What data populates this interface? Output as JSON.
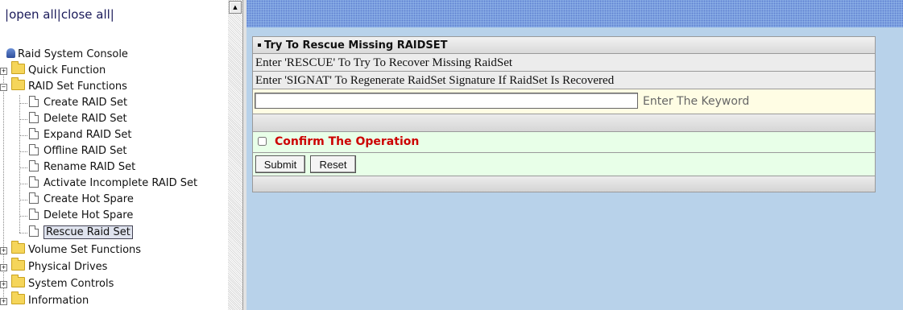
{
  "nav": {
    "open_all": "open all",
    "close_all": "close all",
    "sep": "|"
  },
  "tree": {
    "root": "Raid System Console",
    "quick_function": "Quick Function",
    "raid_set_functions": "RAID Set Functions",
    "raid_children": [
      "Create RAID Set",
      "Delete RAID Set",
      "Expand RAID Set",
      "Offline RAID Set",
      "Rename RAID Set",
      "Activate Incomplete RAID Set",
      "Create Hot Spare",
      "Delete Hot Spare",
      "Rescue Raid Set"
    ],
    "volume_set_functions": "Volume Set Functions",
    "physical_drives": "Physical Drives",
    "system_controls": "System Controls",
    "information": "Information"
  },
  "panel": {
    "header": "Try To Rescue Missing RAIDSET",
    "line1": "Enter 'RESCUE' To Try To Recover Missing RaidSet",
    "line2": "Enter 'SIGNAT' To Regenerate RaidSet Signature If RaidSet Is Recovered",
    "keyword_value": "",
    "keyword_hint": "Enter The Keyword",
    "confirm_label": "Confirm The Operation",
    "submit_label": "Submit",
    "reset_label": "Reset"
  }
}
